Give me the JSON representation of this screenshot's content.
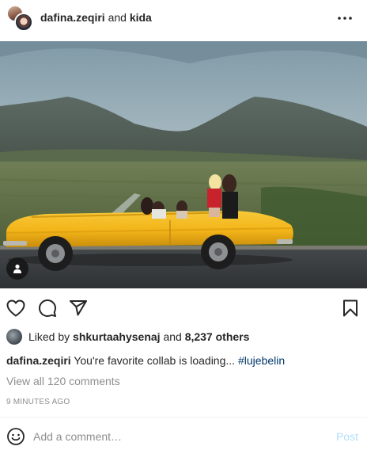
{
  "post": {
    "owner": "dafina.zeqiri",
    "and_text": "and",
    "collaborator": "kida",
    "more_icon": "more-horizontal-icon"
  },
  "photo": {
    "tag_icon": "user-tag-icon"
  },
  "actions": {
    "like_icon": "heart-icon",
    "comment_icon": "comment-icon",
    "share_icon": "paper-plane-icon",
    "save_icon": "bookmark-icon"
  },
  "likes": {
    "prefix": "Liked by",
    "user": "shkurtaahysenaj",
    "middle": "and",
    "others": "8,237 others"
  },
  "caption": {
    "user": "dafina.zeqiri",
    "text": "You're favorite collab is loading...",
    "hashtag": "#lujebelin"
  },
  "comments": {
    "view_all": "View all 120 comments"
  },
  "timestamp": "9 MINUTES AGO",
  "comment_box": {
    "placeholder": "Add a comment…",
    "post_label": "Post",
    "emoji_icon": "smiley-icon"
  },
  "colors": {
    "text": "#262626",
    "muted": "#8e8e8e",
    "link": "#00376b",
    "post_disabled": "#b2dffc",
    "car": "#f2b418"
  }
}
